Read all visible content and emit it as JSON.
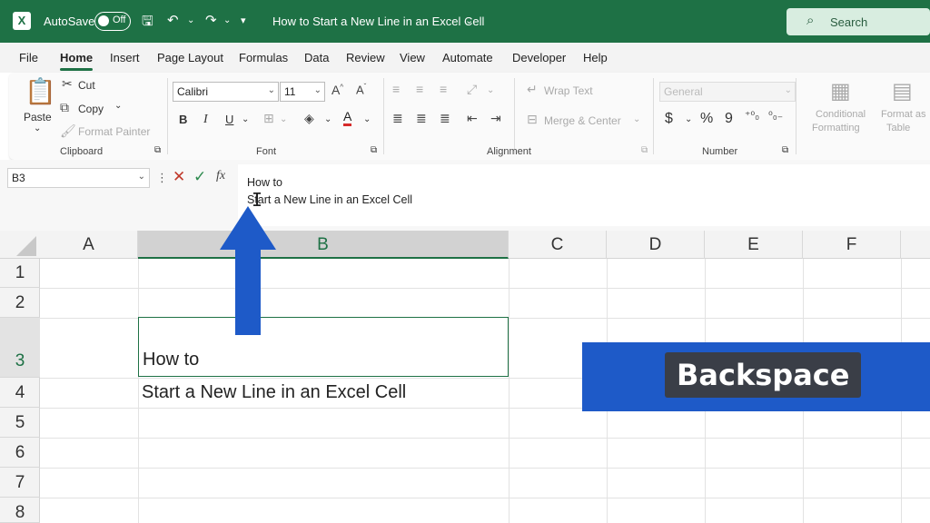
{
  "titlebar": {
    "logo": "X",
    "autosave_label": "AutoSave",
    "autosave_state": "Off",
    "document_title": "How to Start a New Line in an Excel Cell",
    "search_placeholder": "Search",
    "icons": [
      "excel-logo-icon",
      "save-icon",
      "undo-icon",
      "redo-icon",
      "customize-icon",
      "search-icon"
    ]
  },
  "menu": {
    "tabs": [
      "File",
      "Home",
      "Insert",
      "Page Layout",
      "Formulas",
      "Data",
      "Review",
      "View",
      "Automate",
      "Developer",
      "Help"
    ],
    "active": "Home"
  },
  "ribbon": {
    "clipboard": {
      "label": "Clipboard",
      "paste": "Paste",
      "cut": "Cut",
      "copy": "Copy",
      "format_painter": "Format Painter"
    },
    "font": {
      "label": "Font",
      "family": "Calibri",
      "size": "11",
      "bold": "B",
      "italic": "I",
      "underline": "U"
    },
    "alignment": {
      "label": "Alignment",
      "wrap_text": "Wrap Text",
      "merge_center": "Merge & Center"
    },
    "number": {
      "label": "Number",
      "format": "General",
      "currency": "$",
      "percent": "%",
      "comma": "9"
    },
    "styles": {
      "conditional_formatting": "Conditional",
      "conditional_formatting_2": "Formatting",
      "format_as_table": "Format as",
      "format_as_table_2": "Table"
    }
  },
  "formula_bar": {
    "name_box": "B3",
    "fx": "fx",
    "line1": "How to",
    "line2": "Start a New Line in an Excel Cell"
  },
  "grid": {
    "columns": [
      "A",
      "B",
      "C",
      "D",
      "E",
      "F"
    ],
    "selected_column": "B",
    "rows": [
      "1",
      "2",
      "3",
      "4",
      "5",
      "6",
      "7",
      "8"
    ],
    "selected_row": "3",
    "active_cell": {
      "ref": "B3",
      "line1": "How to",
      "line2": "Start a New Line in an Excel Cell"
    }
  },
  "overlay": {
    "key_label": "Backspace",
    "banner_color": "#1e5ac8",
    "arrow_color": "#1e5ac8"
  },
  "colors": {
    "brand_green": "#1e7145",
    "search_bg": "#d8ede0"
  }
}
